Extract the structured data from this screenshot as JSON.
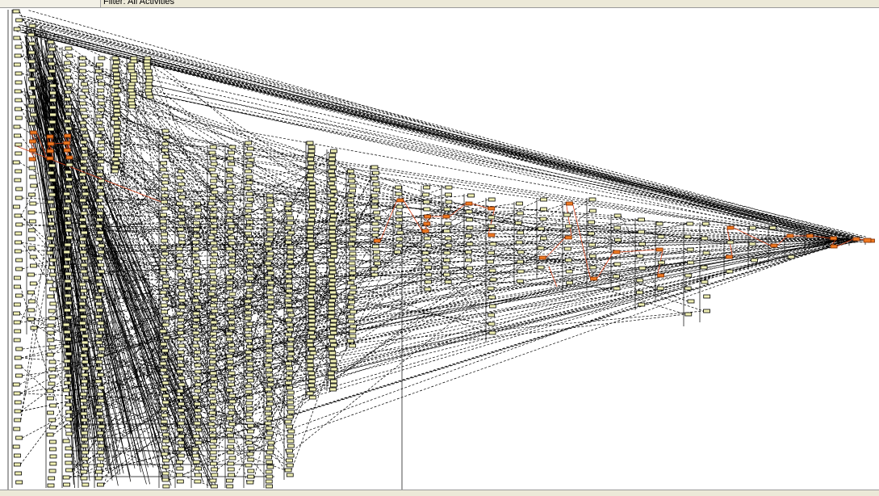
{
  "toolbar": {
    "filter_label": "Filter: All Activities"
  },
  "colors": {
    "activity_fill": "#f0f0b4",
    "critical_fill": "#f07a22",
    "relationship_line": "#000000",
    "critical_line": "#d8431a"
  }
}
